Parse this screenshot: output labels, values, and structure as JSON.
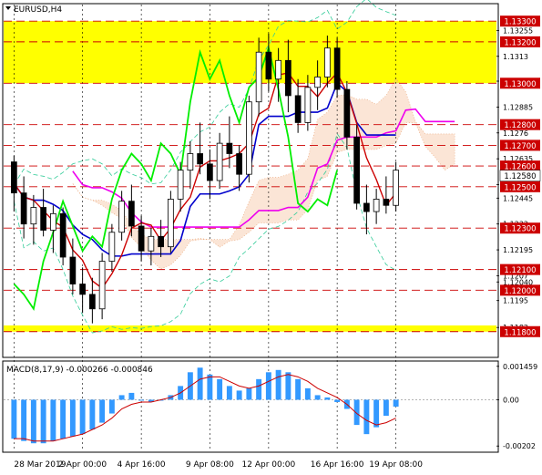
{
  "window": {
    "title": "EURUSD,H4",
    "dropdown_icon": "triangle-down-icon"
  },
  "chart_data": [
    {
      "type": "candlestick",
      "symbol": "EURUSD",
      "timeframe": "H4",
      "title": "EURUSD,H4",
      "ylim": [
        1.1168,
        1.1338
      ],
      "price_ticks": [
        1.13255,
        1.1313,
        1.1301,
        1.12885,
        1.1276,
        1.12635,
        1.1251,
        1.12445,
        1.1232,
        1.12195,
        1.1207,
        1.1204,
        1.1195,
        1.1182
      ],
      "price_tick_labels": [
        "1.13255",
        "1.1313",
        "1.1301",
        "1.12885",
        "1.1276",
        "1.12635",
        "1.1251",
        "1.12445",
        "1.1232",
        "1.12195",
        "1.1207",
        "1.12040",
        "1.1195",
        "1.1182"
      ],
      "level_lines": [
        1.133,
        1.132,
        1.13,
        1.128,
        1.127,
        1.126,
        1.125,
        1.123,
        1.121,
        1.12,
        1.118
      ],
      "level_labels": [
        "1.13300",
        "1.13200",
        "1.13000",
        "1.12800",
        "1.12700",
        "1.12600",
        "1.12500",
        "1.12300",
        "1.12100",
        "1.12000",
        "1.11800"
      ],
      "current_price_label": "1.12580",
      "x_labels": [
        "28 Mar 2019",
        "2 Apr 00:00",
        "4 Apr 16:00",
        "9 Apr 08:00",
        "12 Apr 00:00",
        "16 Apr 16:00",
        "19 Apr 08:00"
      ],
      "zones": [
        {
          "from": 1.13,
          "to": 1.133,
          "color": "#ffff00"
        },
        {
          "from": 1.118,
          "to": 1.1183,
          "color": "#ffff00"
        }
      ],
      "candles": [
        [
          1.1262,
          1.1265,
          1.1238,
          1.1247
        ],
        [
          1.1247,
          1.1255,
          1.1225,
          1.1232
        ],
        [
          1.1232,
          1.1246,
          1.1222,
          1.124
        ],
        [
          1.124,
          1.1249,
          1.1226,
          1.1229
        ],
        [
          1.1229,
          1.1241,
          1.1218,
          1.1237
        ],
        [
          1.1237,
          1.124,
          1.1212,
          1.1216
        ],
        [
          1.1216,
          1.1225,
          1.1198,
          1.1203
        ],
        [
          1.1203,
          1.1211,
          1.1189,
          1.1198
        ],
        [
          1.1198,
          1.1206,
          1.1184,
          1.1191
        ],
        [
          1.1191,
          1.1218,
          1.1186,
          1.1214
        ],
        [
          1.1214,
          1.1232,
          1.1209,
          1.1228
        ],
        [
          1.1228,
          1.1248,
          1.1224,
          1.1243
        ],
        [
          1.1243,
          1.1251,
          1.1226,
          1.1231
        ],
        [
          1.1231,
          1.1236,
          1.1214,
          1.1219
        ],
        [
          1.1219,
          1.123,
          1.1212,
          1.1226
        ],
        [
          1.1226,
          1.1234,
          1.1216,
          1.1221
        ],
        [
          1.1221,
          1.1248,
          1.1218,
          1.1244
        ],
        [
          1.1244,
          1.1262,
          1.1238,
          1.1258
        ],
        [
          1.1258,
          1.1272,
          1.1249,
          1.1266
        ],
        [
          1.1266,
          1.1281,
          1.1256,
          1.1261
        ],
        [
          1.1261,
          1.1268,
          1.1244,
          1.1253
        ],
        [
          1.1253,
          1.1276,
          1.1249,
          1.1271
        ],
        [
          1.1271,
          1.1284,
          1.1259,
          1.1266
        ],
        [
          1.1266,
          1.127,
          1.1248,
          1.1256
        ],
        [
          1.1256,
          1.1294,
          1.1252,
          1.1291
        ],
        [
          1.1291,
          1.1322,
          1.1284,
          1.1315
        ],
        [
          1.1315,
          1.1324,
          1.1296,
          1.1302
        ],
        [
          1.1302,
          1.1317,
          1.1291,
          1.1311
        ],
        [
          1.1311,
          1.1321,
          1.1286,
          1.1294
        ],
        [
          1.1294,
          1.1302,
          1.1276,
          1.1281
        ],
        [
          1.1281,
          1.1304,
          1.1277,
          1.1298
        ],
        [
          1.1298,
          1.1311,
          1.1287,
          1.1303
        ],
        [
          1.1303,
          1.1323,
          1.1298,
          1.1317
        ],
        [
          1.1317,
          1.1322,
          1.1293,
          1.1297
        ],
        [
          1.1297,
          1.1301,
          1.1268,
          1.1274
        ],
        [
          1.1274,
          1.128,
          1.1239,
          1.1242
        ],
        [
          1.1242,
          1.1251,
          1.1227,
          1.1238
        ],
        [
          1.1238,
          1.1249,
          1.1232,
          1.1244
        ],
        [
          1.1244,
          1.1255,
          1.1237,
          1.1241
        ],
        [
          1.1241,
          1.1262,
          1.1238,
          1.1258
        ]
      ]
    },
    {
      "type": "bar",
      "indicator": "MACD",
      "title": "MACD(8,17,9) -0.000266 -0.000846",
      "y_ticks": [
        0.001459,
        0.0,
        -0.00202
      ],
      "y_tick_labels": [
        "0.001459",
        "0.00",
        "-0.00202"
      ],
      "ylim": [
        -0.00225,
        0.00165
      ],
      "series": [
        {
          "name": "MACD",
          "color": "#3399ff",
          "values": [
            -0.0017,
            -0.0018,
            -0.0019,
            -0.0019,
            -0.0018,
            -0.0017,
            -0.0016,
            -0.0015,
            -0.0013,
            -0.001,
            -0.0006,
            0.0002,
            0.0003,
            0.0,
            -0.0001,
            0.0,
            0.0002,
            0.0006,
            0.0012,
            0.0014,
            0.0011,
            0.0009,
            0.0006,
            0.0004,
            0.0005,
            0.0009,
            0.0012,
            0.0013,
            0.0012,
            0.0009,
            0.0005,
            0.0002,
            0.0001,
            -0.0001,
            -0.0004,
            -0.0011,
            -0.0015,
            -0.0012,
            -0.0007,
            -0.0003
          ]
        },
        {
          "name": "Signal",
          "color": "#cc0000",
          "values": [
            -0.0017,
            -0.0017,
            -0.0018,
            -0.0018,
            -0.0018,
            -0.0017,
            -0.0016,
            -0.0015,
            -0.0013,
            -0.0011,
            -0.0008,
            -0.0004,
            -0.0002,
            -0.0001,
            -0.0001,
            0.0,
            0.0001,
            0.0003,
            0.0006,
            0.0009,
            0.001,
            0.001,
            0.0008,
            0.0006,
            0.0005,
            0.0006,
            0.0008,
            0.001,
            0.0011,
            0.001,
            0.0008,
            0.0005,
            0.0003,
            0.0001,
            -0.0002,
            -0.0006,
            -0.0009,
            -0.0011,
            -0.001,
            -0.0008
          ]
        }
      ]
    }
  ],
  "colors": {
    "bull": "#000000",
    "bear": "#000000",
    "ichimoku_tenkan": "#cc0000",
    "ichimoku_kijun": "#0000cc",
    "ichimoku_chikou": "#00ee00",
    "senkou_line": "#ee00ee",
    "bollinger": "#33cc99",
    "level": "#cc0000",
    "label_bg": "#cc0000",
    "label_fg": "#ffffff"
  }
}
